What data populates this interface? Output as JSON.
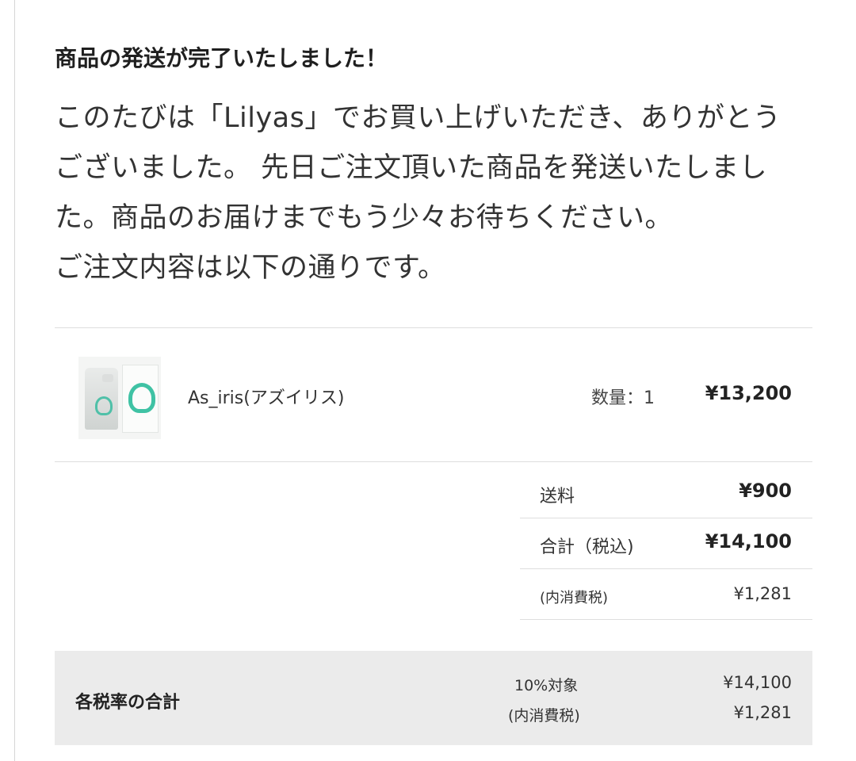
{
  "message": {
    "headline": "商品の発送が完了いたしました！",
    "lines": [
      "このたびは「Lilyas」でお買い上げいただき、ありがとう",
      "ございました。 先日ご注文頂いた商品を発送いたしまし",
      "た。商品のお届けまでもう少々お待ちください。",
      "ご注文内容は以下の通りです。"
    ]
  },
  "order": {
    "item": {
      "name": "As_iris(アズイリス)",
      "quantity": "数量：1",
      "price": "¥13,200",
      "thumbnail": "product-thumbnail-image"
    },
    "summary": {
      "shipping_label": "送料",
      "shipping_value": "¥900",
      "total_label": "合計（税込)",
      "total_value": "¥14,100",
      "tax_label": "(内消費税)",
      "tax_value": "¥1,281"
    },
    "tax_rates": {
      "title": "各税率の合計",
      "rate_label": "10%対象",
      "rate_value": "¥14,100",
      "tax_label": "(内消費税)",
      "tax_value": "¥1,281"
    }
  },
  "colors": {
    "accent_logo": "#3fc2a4",
    "tax_box_background": "#ebebeb",
    "rule": "#dedede"
  }
}
